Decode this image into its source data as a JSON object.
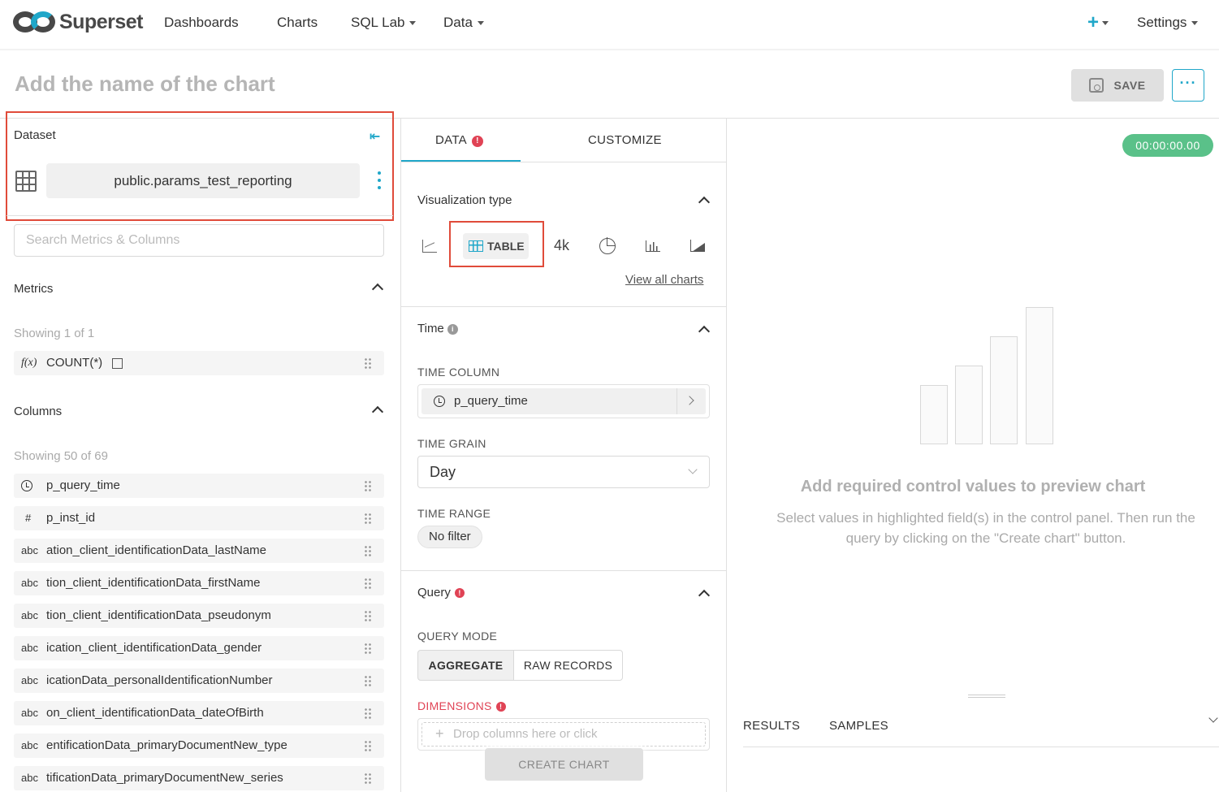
{
  "navbar": {
    "brand": "Superset",
    "items": [
      {
        "label": "Dashboards"
      },
      {
        "label": "Charts"
      },
      {
        "label": "SQL Lab"
      },
      {
        "label": "Data"
      }
    ],
    "plus": "+",
    "settings": "Settings"
  },
  "header": {
    "chart_name_placeholder": "Add the name of the chart",
    "save_label": "SAVE",
    "more_label": "···"
  },
  "dataset": {
    "label": "Dataset",
    "name": "public.params_test_reporting",
    "search_placeholder": "Search Metrics & Columns"
  },
  "metrics": {
    "title": "Metrics",
    "showing": "Showing 1 of 1",
    "items": [
      {
        "icon": "f(x)",
        "label": "COUNT(*)"
      }
    ]
  },
  "columns": {
    "title": "Columns",
    "showing": "Showing 50 of 69",
    "items": [
      {
        "type": "clock",
        "label": "p_query_time"
      },
      {
        "type": "#",
        "label": "p_inst_id"
      },
      {
        "type": "abc",
        "label": "ation_client_identificationData_lastName"
      },
      {
        "type": "abc",
        "label": "tion_client_identificationData_firstName"
      },
      {
        "type": "abc",
        "label": "tion_client_identificationData_pseudonym"
      },
      {
        "type": "abc",
        "label": "ication_client_identificationData_gender"
      },
      {
        "type": "abc",
        "label": "icationData_personalIdentificationNumber"
      },
      {
        "type": "abc",
        "label": "on_client_identificationData_dateOfBirth"
      },
      {
        "type": "abc",
        "label": "entificationData_primaryDocumentNew_type"
      },
      {
        "type": "abc",
        "label": "tificationData_primaryDocumentNew_series"
      }
    ]
  },
  "tabs": {
    "data": "DATA",
    "customize": "CUSTOMIZE",
    "error_mark": "!"
  },
  "viz": {
    "title": "Visualization type",
    "table_label": "TABLE",
    "big_number_label": "4k",
    "view_all": "View all charts"
  },
  "time": {
    "title": "Time",
    "info_mark": "i",
    "column_label": "TIME COLUMN",
    "column_value": "p_query_time",
    "grain_label": "TIME GRAIN",
    "grain_value": "Day",
    "range_label": "TIME RANGE",
    "range_value": "No filter"
  },
  "query": {
    "title": "Query",
    "mode_label": "QUERY MODE",
    "mode_aggregate": "AGGREGATE",
    "mode_raw": "RAW RECORDS",
    "dimensions_label": "DIMENSIONS",
    "drop_placeholder": "Drop columns here or click",
    "create_chart": "CREATE CHART"
  },
  "preview": {
    "timer": "00:00:00.00",
    "empty_title": "Add required control values to preview chart",
    "empty_desc": "Select values in highlighted field(s) in the control panel. Then run the query by clicking on the \"Create chart\" button.",
    "tab_results": "RESULTS",
    "tab_samples": "SAMPLES"
  },
  "colors": {
    "accent": "#20a7c9",
    "highlight_box": "#e04b3a",
    "error": "#e04355",
    "timer_bg": "#5ac189"
  }
}
